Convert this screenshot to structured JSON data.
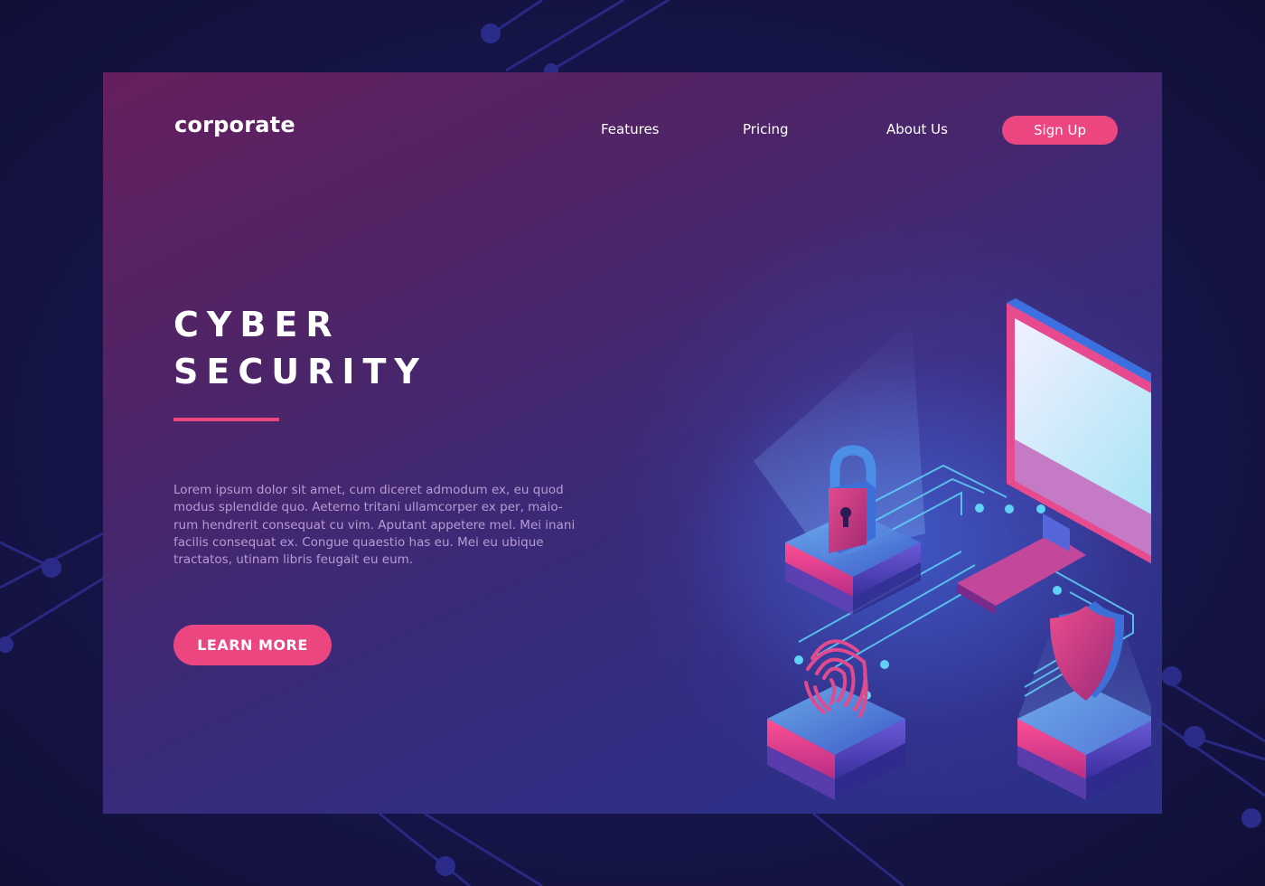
{
  "brand": {
    "logo": "corporate"
  },
  "nav": {
    "features": "Features",
    "pricing": "Pricing",
    "about": "About Us",
    "signup": "Sign Up"
  },
  "hero": {
    "title_line1": "CYBER",
    "title_line2": "SECURITY",
    "description": "Lorem ipsum dolor sit amet, cum diceret admodum ex, eu quod modus splendide quo. Aeterno tritani ullamcorper ex per, maio-rum hendrerit consequat cu vim. Aputant appetere mel. Mei inani facilis consequat ex. Congue quaestio has eu. Mei eu ubique tractatos, utinam libris feugait eu eum.",
    "cta": "LEARN MORE"
  },
  "illustration": {
    "icons": [
      "monitor-icon",
      "padlock-icon",
      "fingerprint-icon",
      "shield-icon"
    ]
  },
  "colors": {
    "accent": "#ec4680",
    "page_background": "#15143f",
    "card_gradient_start": "#661f5e",
    "card_gradient_end": "#2c3089",
    "circuit_glow": "#5fd2f5"
  }
}
